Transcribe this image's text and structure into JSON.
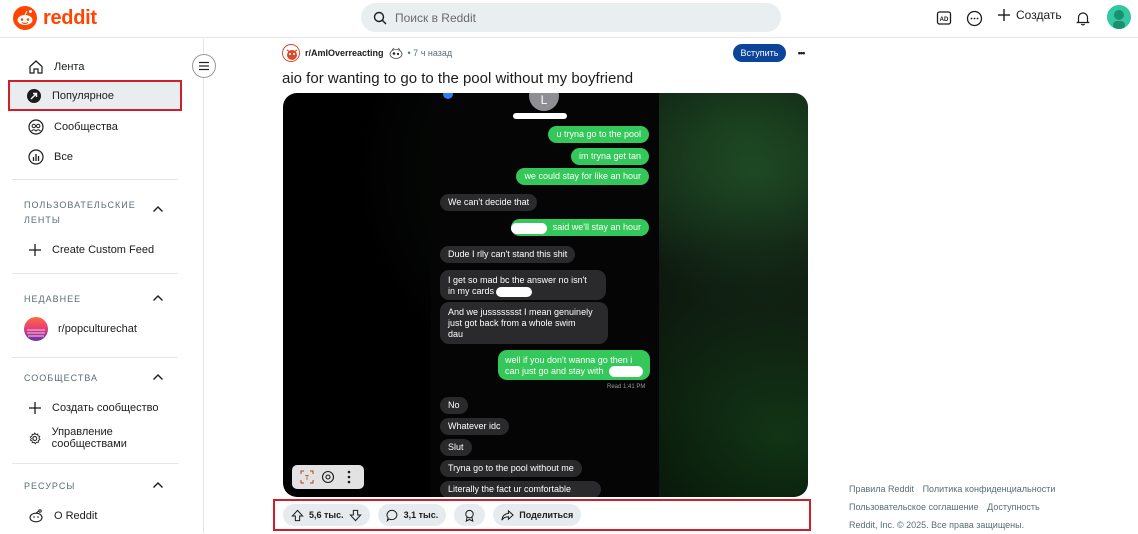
{
  "header": {
    "logo_text": "reddit",
    "search_placeholder": "Поиск в Reddit",
    "create_label": "Создать",
    "icons": [
      "advertise-icon",
      "chat-icon",
      "plus-icon",
      "bell-icon",
      "avatar"
    ]
  },
  "sidebar": {
    "items": [
      {
        "label": "Лента",
        "icon": "home-icon"
      },
      {
        "label": "Популярное",
        "icon": "popular-icon"
      },
      {
        "label": "Сообщества",
        "icon": "communities-icon"
      },
      {
        "label": "Все",
        "icon": "all-icon"
      }
    ],
    "custom_feeds": {
      "title": "ПОЛЬЗОВАТЕЛЬСКИЕ ЛЕНТЫ",
      "create_label": "Create Custom Feed"
    },
    "recent": {
      "title": "НЕДАВНЕЕ",
      "items": [
        {
          "label": "r/popculturechat"
        }
      ]
    },
    "communities": {
      "title": "СООБЩЕСТВА",
      "create_label": "Создать сообщество",
      "manage_label": "Управление сообществами"
    },
    "resources": {
      "title": "РЕСУРСЫ",
      "about_label": "О Reddit"
    }
  },
  "post": {
    "subreddit": "r/AmIOverreacting",
    "time": "• 7 ч назад",
    "join_label": "Вступить",
    "more_label": "•••",
    "title": "aio for wanting to go to the pool without my boyfriend",
    "header_initial": "L",
    "messages": [
      {
        "text": "u tryna go to the pool"
      },
      {
        "text": "im tryna get tan"
      },
      {
        "text": "we could stay for like an hour"
      },
      {
        "text": "We can't decide that"
      },
      {
        "text": "said we'll stay an hour"
      },
      {
        "text": "Dude I rlly can't stand this shit"
      },
      {
        "text": "I get so mad bc the answer no isn't"
      },
      {
        "text": "in my cards"
      },
      {
        "text": "And we jussssssst I mean genuinely"
      },
      {
        "text": "just got back from a whole swim"
      },
      {
        "text": "dau"
      },
      {
        "text": "well if you don't wanna go then i"
      },
      {
        "text": "can just go and stay with"
      },
      {
        "text": "Read 1:41 PM"
      },
      {
        "text": "No"
      },
      {
        "text": "Whatever idc"
      },
      {
        "text": "Slut"
      },
      {
        "text": "Tryna go to the pool without me"
      },
      {
        "text": "Literally the fact ur comfortable"
      }
    ],
    "upvotes": "5,6 тыс.",
    "comments": "3,1 тыс.",
    "share_label": "Поделиться"
  },
  "footer": {
    "links": [
      "Правила Reddit",
      "Политика конфиденциальности",
      "Пользовательское соглашение",
      "Доступность"
    ],
    "copyright": "Reddit, Inc. © 2025. Все права защищены."
  },
  "colors": {
    "brand": "#ff4500",
    "join_button": "#0a449b",
    "highlight_box": "#d11f2a",
    "sent_bubble": "#34c759",
    "received_bubble": "#2a2a2c"
  }
}
